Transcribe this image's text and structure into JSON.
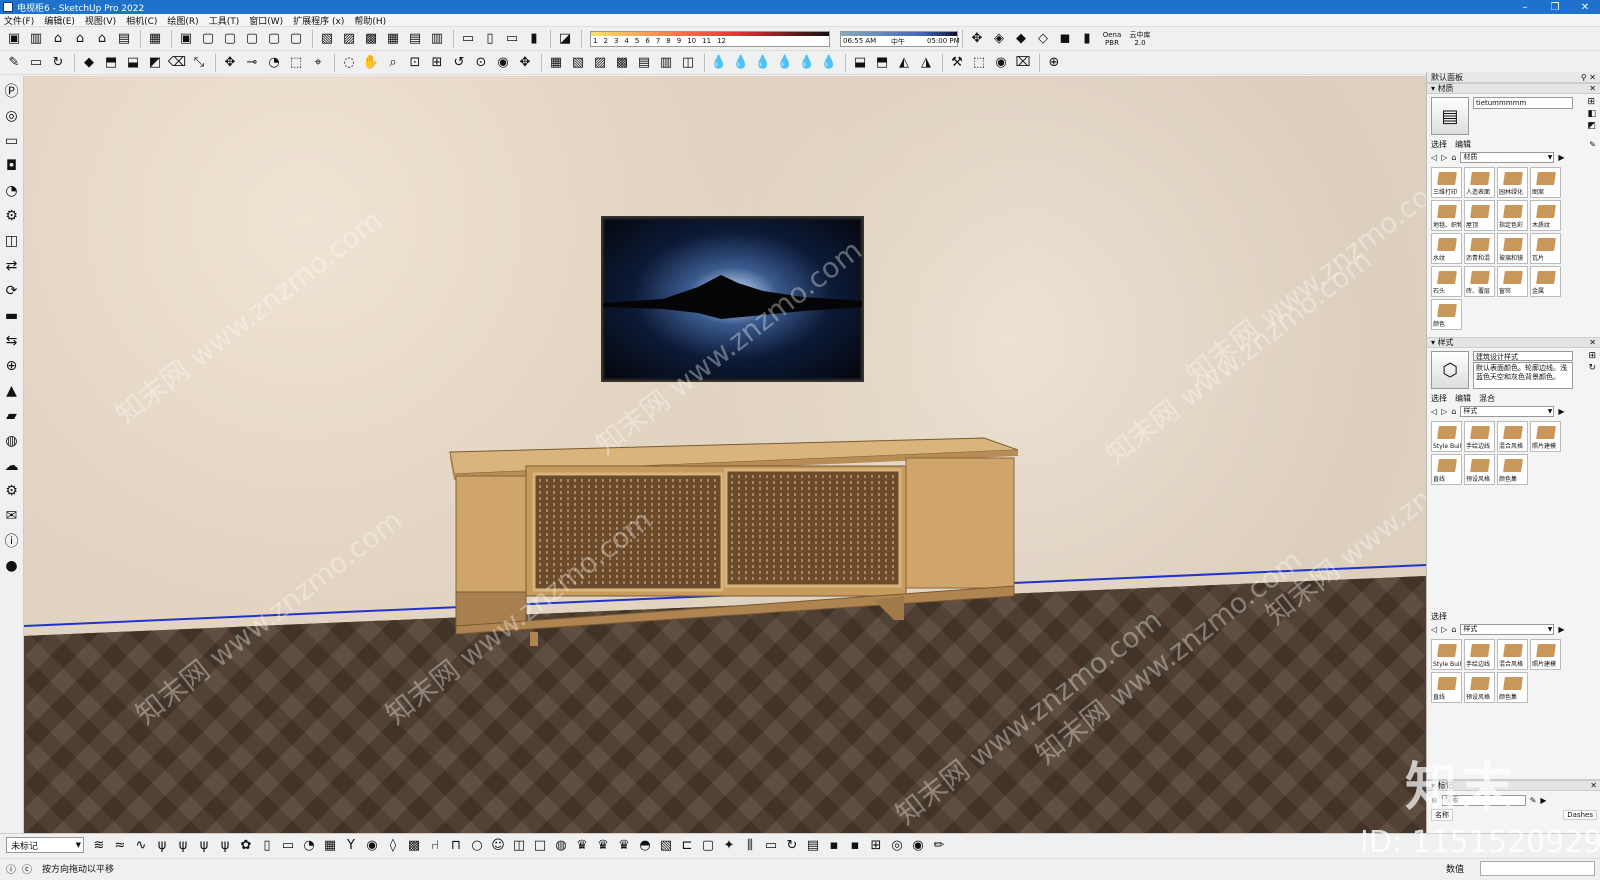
{
  "window": {
    "title": "电视柜6 - SketchUp Pro 2022",
    "controls": [
      "–",
      "❐",
      "✕"
    ]
  },
  "menubar": {
    "items": [
      "文件(F)",
      "编辑(E)",
      "视图(V)",
      "相机(C)",
      "绘图(R)",
      "工具(T)",
      "窗口(W)",
      "扩展程序 (x)",
      "帮助(H)"
    ]
  },
  "toolbar1": {
    "groups": [
      [
        "component-icon",
        "book-icon",
        "home-icon",
        "house-icon",
        "home-outline-icon",
        "store-icon"
      ],
      [
        "cube-stack-icon"
      ],
      [
        "iso-icon",
        "top-icon",
        "front-icon",
        "right-icon",
        "back-icon",
        "left-icon"
      ],
      [
        "xray-icon",
        "wireframe-icon",
        "hidden-line-icon",
        "shaded-icon",
        "textured-icon",
        "monochrome-icon"
      ],
      [
        "section-plane-icon",
        "section-display-icon",
        "section-cut-icon",
        "section-fill-icon"
      ],
      [
        "shadow-toggle-icon"
      ]
    ],
    "shadow_months": [
      "1",
      "2",
      "3",
      "4",
      "5",
      "6",
      "7",
      "8",
      "9",
      "10",
      "11",
      "12"
    ],
    "shadow_time": {
      "start": "06:55 AM",
      "mid": "中午",
      "end": "05:00 PM"
    },
    "right_groups": [
      "walk-icon",
      "warehouse-icon",
      "extension-warehouse-icon",
      "share-icon",
      "ruby-cube-icon",
      "palette-icon"
    ],
    "enscape_label": "Oena PBR",
    "cloud_label": "云中库2.0"
  },
  "toolbar2": {
    "icons": [
      "pencil-icon",
      "rectangle-icon",
      "rotate-icon",
      "paint-bucket-icon",
      "push-pull-icon",
      "follow-me-icon",
      "offset-icon",
      "eraser-icon",
      "scale-icon",
      "move-icon",
      "tape-icon",
      "protractor-icon",
      "make-component-icon",
      "select-icon",
      "orbit-icon",
      "pan-icon",
      "zoom-icon",
      "zoom-window-icon",
      "zoom-extents-icon",
      "previous-icon",
      "position-camera-icon",
      "look-around-icon",
      "walk-icon",
      "sandbox-icon",
      "contours-icon",
      "smoove-icon",
      "stamp-icon",
      "drape-icon",
      "add-detail-icon",
      "flip-edge-icon",
      "water-drop-icon",
      "water-drop-2-icon",
      "water-drop-3-icon",
      "water-drop-4-icon",
      "water-drop-5-icon",
      "water-drop-6-icon",
      "solid-union-icon",
      "solid-subtract-icon",
      "solid-trim-icon",
      "solid-split-icon",
      "tools-icon",
      "dynamic-component-icon",
      "globe-icon",
      "text-icon",
      "add-location-icon"
    ]
  },
  "lefttoolbar": {
    "icons": [
      "purple-p-icon",
      "record-icon",
      "video-icon",
      "camera-icon",
      "lightbulb-icon",
      "gear-outline-icon",
      "cube-outline-icon",
      "orange-swap-icon",
      "green-cycle-icon",
      "red-film-icon",
      "orange-arrows-icon",
      "circle-plus-icon",
      "green-tree-icon",
      "orange-block-icon",
      "checker-ball-icon",
      "cloud-upload-icon",
      "settings-icon",
      "envelope-icon",
      "info-icon",
      "user-icon"
    ]
  },
  "tray": {
    "title": "默认面板",
    "materials": {
      "section_title": "材质",
      "name": "tietummmmm",
      "tabs": [
        "选择",
        "编辑"
      ],
      "dropdown": "材质",
      "items": [
        "三维打印",
        "人造表面",
        "园林绿化",
        "图案",
        "地毯、织物",
        "屋顶",
        "指定色彩",
        "木质纹",
        "水纹",
        "沥青和混",
        "玻璃和镜",
        "瓦片",
        "石头",
        "砖、覆层",
        "窗帘",
        "金属",
        "颜色"
      ]
    },
    "styles": {
      "section_title": "样式",
      "name": "建筑设计样式",
      "description": "默认表面颜色。轮廓边线。浅蓝色天空和灰色背景颜色。",
      "tabs": [
        "选择",
        "编辑",
        "混合"
      ],
      "dropdown": "样式",
      "items": [
        "Style Buil",
        "手绘边线",
        "混合风格",
        "照片建模",
        "直线",
        "预设风格",
        "颜色集"
      ]
    },
    "mix": {
      "tab": "选择",
      "dropdown": "样式",
      "items": [
        "Style Buil",
        "手绘边线",
        "混合风格",
        "照片建模",
        "直线",
        "预设风格",
        "颜色集"
      ]
    },
    "bottom": {
      "section_title": "标记",
      "search_placeholder": "搜索",
      "col_name": "名称",
      "col_dashes": "Dashes"
    }
  },
  "statusbar": {
    "tag_value": "未标记",
    "hint": "按方向拖动以平移",
    "measurements_label": "数值",
    "bottom_icons": [
      "waves-icon",
      "wave2-icon",
      "wave3-icon",
      "grass-icon",
      "grass2-icon",
      "grass3-icon",
      "grass4-icon",
      "gear-flower-icon",
      "phone-icon",
      "box-icon",
      "bulb-icon",
      "grid-icon",
      "glass-icon",
      "globe2-icon",
      "bottle-icon",
      "checker-icon",
      "chair-icon",
      "sofa-icon",
      "circle-icon",
      "face-icon",
      "door-icon",
      "square-icon",
      "chrome-icon",
      "trophy-icon",
      "trophy2-icon",
      "trophy3-icon",
      "bust-icon",
      "pattern-icon",
      "stairs-icon",
      "frame-icon",
      "star-icon",
      "columns-icon",
      "rect-icon",
      "refresh-icon",
      "box2-icon",
      "save-icon",
      "save2-icon",
      "ratio-icon",
      "eye-off-icon",
      "eye-icon",
      "paintbrush-icon"
    ]
  },
  "viewport": {
    "watermark": "知末网 www.znzmo.com"
  },
  "overlay": {
    "logo": "知末",
    "id_text": "ID: 1151520929"
  },
  "colors": {
    "titlebar": "#1e72cc",
    "wall": "#dfd2c1",
    "floor": "#4f3e31",
    "wood": "#c9a36a",
    "axis_blue": "#2233cc"
  }
}
